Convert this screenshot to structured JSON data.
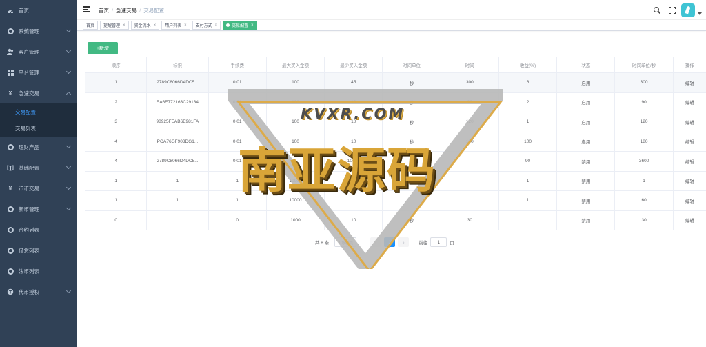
{
  "sidebar": {
    "items": [
      {
        "label": "首页",
        "icon": "dashboard-icon"
      },
      {
        "label": "系统管理",
        "icon": "gear-icon"
      },
      {
        "label": "客户管理",
        "icon": "users-icon"
      },
      {
        "label": "平台管理",
        "icon": "grid-icon"
      },
      {
        "label": "急速交易",
        "icon": "yen-icon"
      }
    ],
    "sub_items": [
      {
        "label": "交易配置"
      },
      {
        "label": "交易列表"
      }
    ],
    "items_after": [
      {
        "label": "理财产品",
        "icon": "gear-icon"
      },
      {
        "label": "基础配置",
        "icon": "book-icon"
      },
      {
        "label": "币币交易",
        "icon": "yen-icon"
      },
      {
        "label": "新币管理",
        "icon": "gear-icon"
      },
      {
        "label": "合约列表",
        "icon": "gear-icon"
      },
      {
        "label": "借贷列表",
        "icon": "gear-icon"
      },
      {
        "label": "法币列表",
        "icon": "gear-icon"
      },
      {
        "label": "代币授权",
        "icon": "coin-icon"
      }
    ]
  },
  "breadcrumb": [
    "首页",
    "急速交易",
    "交易配置"
  ],
  "tags": [
    {
      "label": "首页"
    },
    {
      "label": "提醒管理"
    },
    {
      "label": "资金流水"
    },
    {
      "label": "用户列表"
    },
    {
      "label": "支付方式"
    },
    {
      "label": "交易配置"
    }
  ],
  "add_button": "+新增",
  "table": {
    "headers": [
      "顺序",
      "标识",
      "手续费",
      "最大买入金额",
      "最少买入金额",
      "时间单位",
      "时间",
      "收益(%)",
      "状态",
      "时间单位/秒",
      "操作"
    ],
    "rows": [
      [
        "1",
        "2789C8066D4DC5...",
        "0.01",
        "100",
        "45",
        "秒",
        "300",
        "6",
        "启用",
        "300",
        "编辑"
      ],
      [
        "2",
        "EA6E772163C29134",
        "0.01",
        "100",
        "10",
        "秒",
        "90",
        "2",
        "启用",
        "90",
        "编辑"
      ],
      [
        "3",
        "98925FEAB6E981FA",
        "0.01",
        "100",
        "10",
        "秒",
        "120",
        "1",
        "启用",
        "120",
        "编辑"
      ],
      [
        "4",
        "POA76GF903DG1...",
        "0.01",
        "100",
        "10",
        "秒",
        "180",
        "100",
        "启用",
        "180",
        "编辑"
      ],
      [
        "4",
        "2789C8066D4DC5...",
        "0.01",
        "0",
        "10000",
        "",
        "",
        "90",
        "禁用",
        "3600",
        "编辑"
      ],
      [
        "1",
        "1",
        "1",
        "10000",
        "",
        "",
        "",
        "1",
        "禁用",
        "1",
        "编辑"
      ],
      [
        "1",
        "1",
        "1",
        "10000",
        "",
        "",
        "",
        "1",
        "禁用",
        "60",
        "编辑"
      ],
      [
        "0",
        "",
        "0",
        "1000",
        "10",
        "秒",
        "30",
        "",
        "禁用",
        "30",
        "编辑"
      ]
    ]
  },
  "pagination": {
    "total": "共 8 条",
    "page_size": "10条/页",
    "prev": "‹",
    "current_page": "1",
    "next": "›",
    "goto_label": "前往",
    "goto_value": "1",
    "goto_suffix": "页"
  },
  "watermark": {
    "sub": "KVXR.COM",
    "main": "南亚源码"
  },
  "colors": {
    "sidebar_bg": "#304156",
    "accent_green": "#42b983",
    "link_blue": "#409eff",
    "enabled_green": "#67c23a",
    "disabled_red": "#f56c6c"
  }
}
